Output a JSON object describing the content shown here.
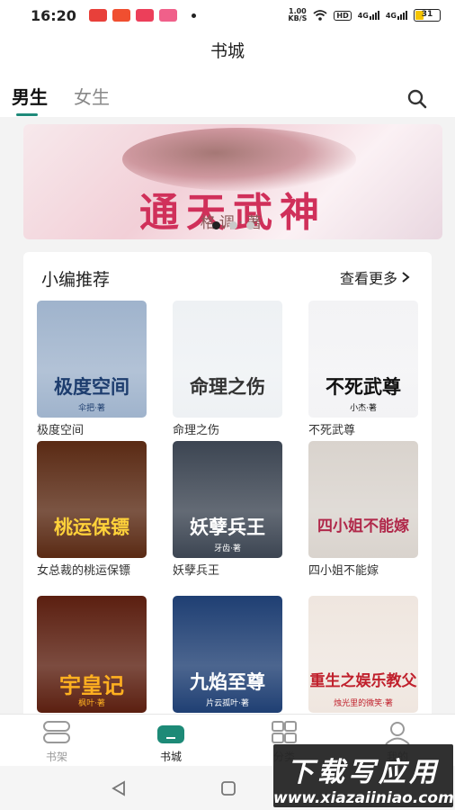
{
  "status_bar": {
    "time": "16:20",
    "net_speed_value": "1.00",
    "net_speed_unit": "KB/S",
    "hd": "HD",
    "signal1": "4G",
    "signal2": "4G",
    "battery": "31",
    "notification_colors": [
      "#e8403a",
      "#f04f30",
      "#ec3f5a",
      "#f0608a"
    ]
  },
  "header": {
    "title": "书城"
  },
  "tabs": {
    "male": "男生",
    "female": "女生"
  },
  "banner": {
    "title": "通天武神",
    "author": "格调·著"
  },
  "recommend": {
    "title": "小编推荐",
    "more": "查看更多",
    "books": [
      {
        "name": "极度空间",
        "cover_title": "极度空间",
        "cover_author": "伞把·著",
        "bg": "#9fb3cc",
        "fg": "#1d3d6e"
      },
      {
        "name": "命理之伤",
        "cover_title": "命理之伤",
        "cover_author": "",
        "bg": "#eef1f4",
        "fg": "#333333"
      },
      {
        "name": "不死武尊",
        "cover_title": "不死武尊",
        "cover_author": "小杰·著",
        "bg": "#f3f3f5",
        "fg": "#111111"
      },
      {
        "name": "女总裁的桃运保镖",
        "cover_title": "桃运保镖",
        "cover_author": "",
        "bg": "#5a2a14",
        "fg": "#ffd23a"
      },
      {
        "name": "妖孽兵王",
        "cover_title": "妖孽兵王",
        "cover_author": "牙齿·著",
        "bg": "#3c4552",
        "fg": "#ffffff"
      },
      {
        "name": "四小姐不能嫁",
        "cover_title": "四小姐不能嫁",
        "cover_author": "",
        "bg": "#d9d3cd",
        "fg": "#b0284a"
      },
      {
        "name": "",
        "cover_title": "宇皇记",
        "cover_author": "枫叶·著",
        "bg": "#5b1f10",
        "fg": "#ffb020"
      },
      {
        "name": "",
        "cover_title": "九焰至尊",
        "cover_author": "片云孤叶·著",
        "bg": "#1f3f73",
        "fg": "#ffffff"
      },
      {
        "name": "",
        "cover_title": "重生之娱乐教父",
        "cover_author": "烛光里的微笑·著",
        "bg": "#efe6df",
        "fg": "#c0202c"
      }
    ]
  },
  "bottom_nav": {
    "shelf": "书架",
    "store": "书城",
    "category": "分类",
    "mine": "我的"
  },
  "watermark": {
    "title": "下载写应用",
    "url": "www.xiazaiiniao.com"
  }
}
